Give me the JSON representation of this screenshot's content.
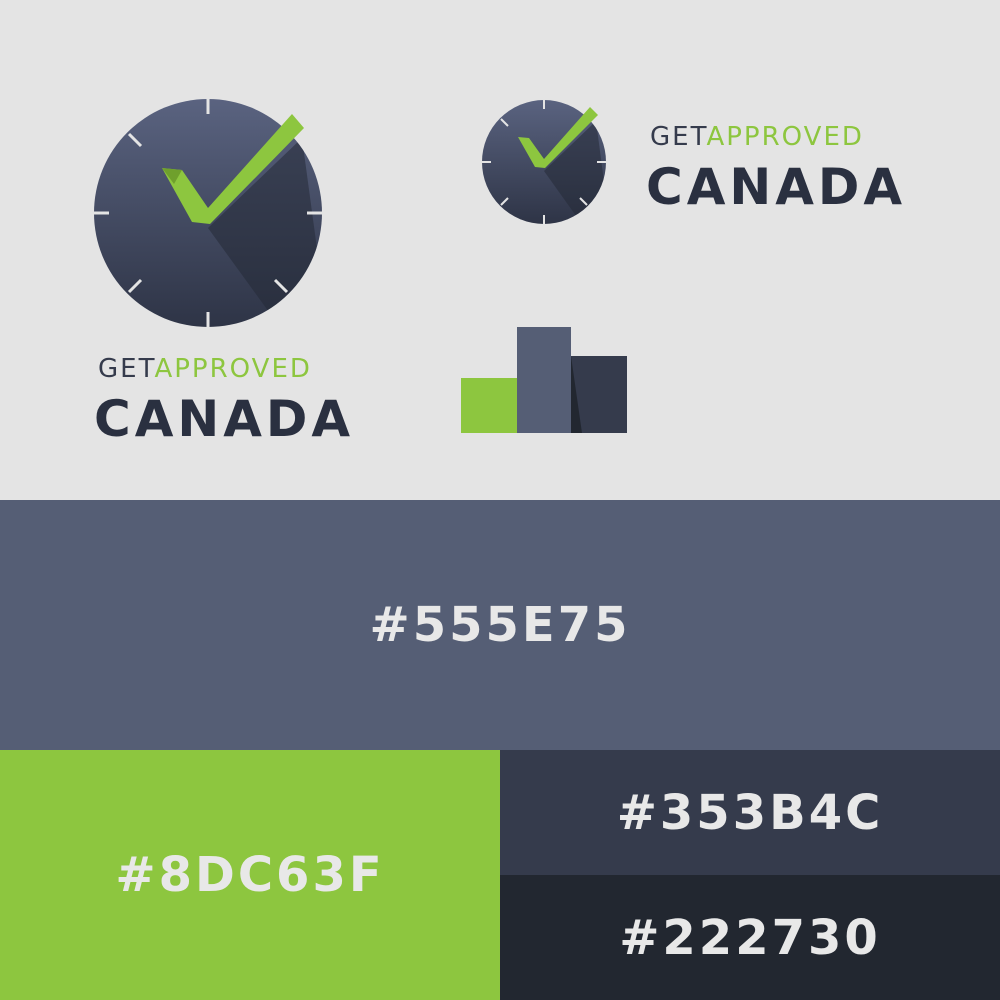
{
  "brand": {
    "get": "GET",
    "approved": "APPROVED",
    "country": "CANADA"
  },
  "icons": {
    "large_logo": "clock-check-icon",
    "small_logo": "clock-check-icon",
    "mark": "bar-chart-icon"
  },
  "palette": [
    {
      "hex": "#555E75",
      "color": "#555e75"
    },
    {
      "hex": "#8DC63F",
      "color": "#8dc63f"
    },
    {
      "hex": "#353B4C",
      "color": "#353b4c"
    },
    {
      "hex": "#222730",
      "color": "#222730"
    }
  ]
}
